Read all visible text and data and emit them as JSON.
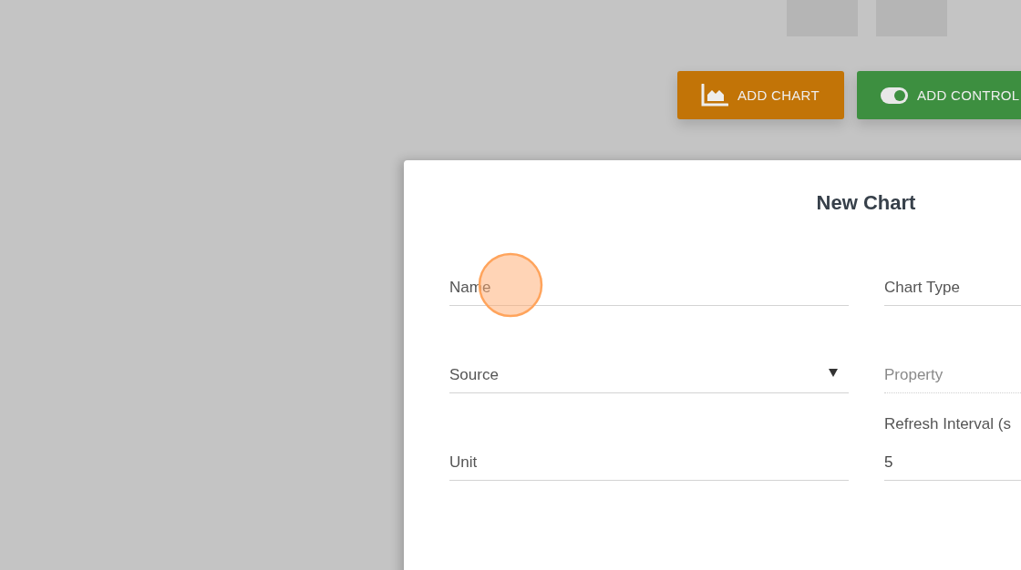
{
  "toolbar": {
    "buttons": [
      {
        "label": "ADD CHART",
        "kind": "chart",
        "color": "#c27407"
      },
      {
        "label": "ADD CONTROL",
        "kind": "control",
        "color": "#3d8f40"
      }
    ]
  },
  "dialog": {
    "title": "New Chart",
    "fields": [
      {
        "label": "Name",
        "kind": "text",
        "disabled": false
      },
      {
        "label": "Source",
        "kind": "select",
        "disabled": false
      },
      {
        "label": "Unit",
        "kind": "text",
        "disabled": false
      },
      {
        "label": "Chart Type",
        "kind": "text",
        "disabled": false
      },
      {
        "label": "Property",
        "kind": "text",
        "disabled": true
      },
      {
        "label": "Refresh Interval (s",
        "kind": "text",
        "disabled": false,
        "value": "5"
      }
    ]
  }
}
